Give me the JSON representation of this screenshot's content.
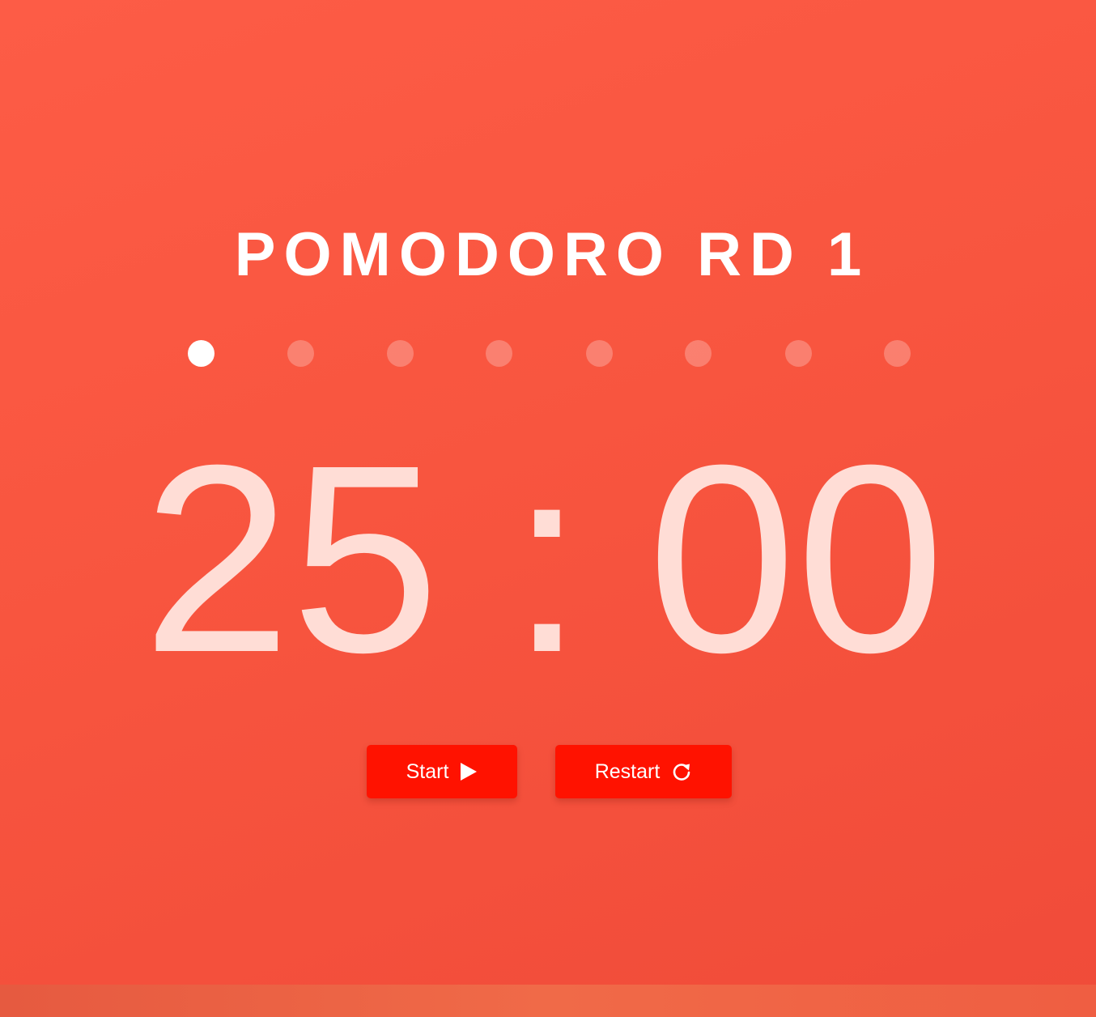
{
  "round": {
    "title": "POMODORO RD 1",
    "total_rounds": 8,
    "current_round": 1
  },
  "timer": {
    "minutes": "25",
    "separator": ":",
    "seconds": "00"
  },
  "controls": {
    "start_label": "Start",
    "start_icon": "play-icon",
    "restart_label": "Restart",
    "restart_icon": "restart-icon"
  },
  "colors": {
    "background": "#f8553f",
    "button": "#ff1200",
    "timer_text": "#ffddd6",
    "active_dot": "#ffffff"
  }
}
